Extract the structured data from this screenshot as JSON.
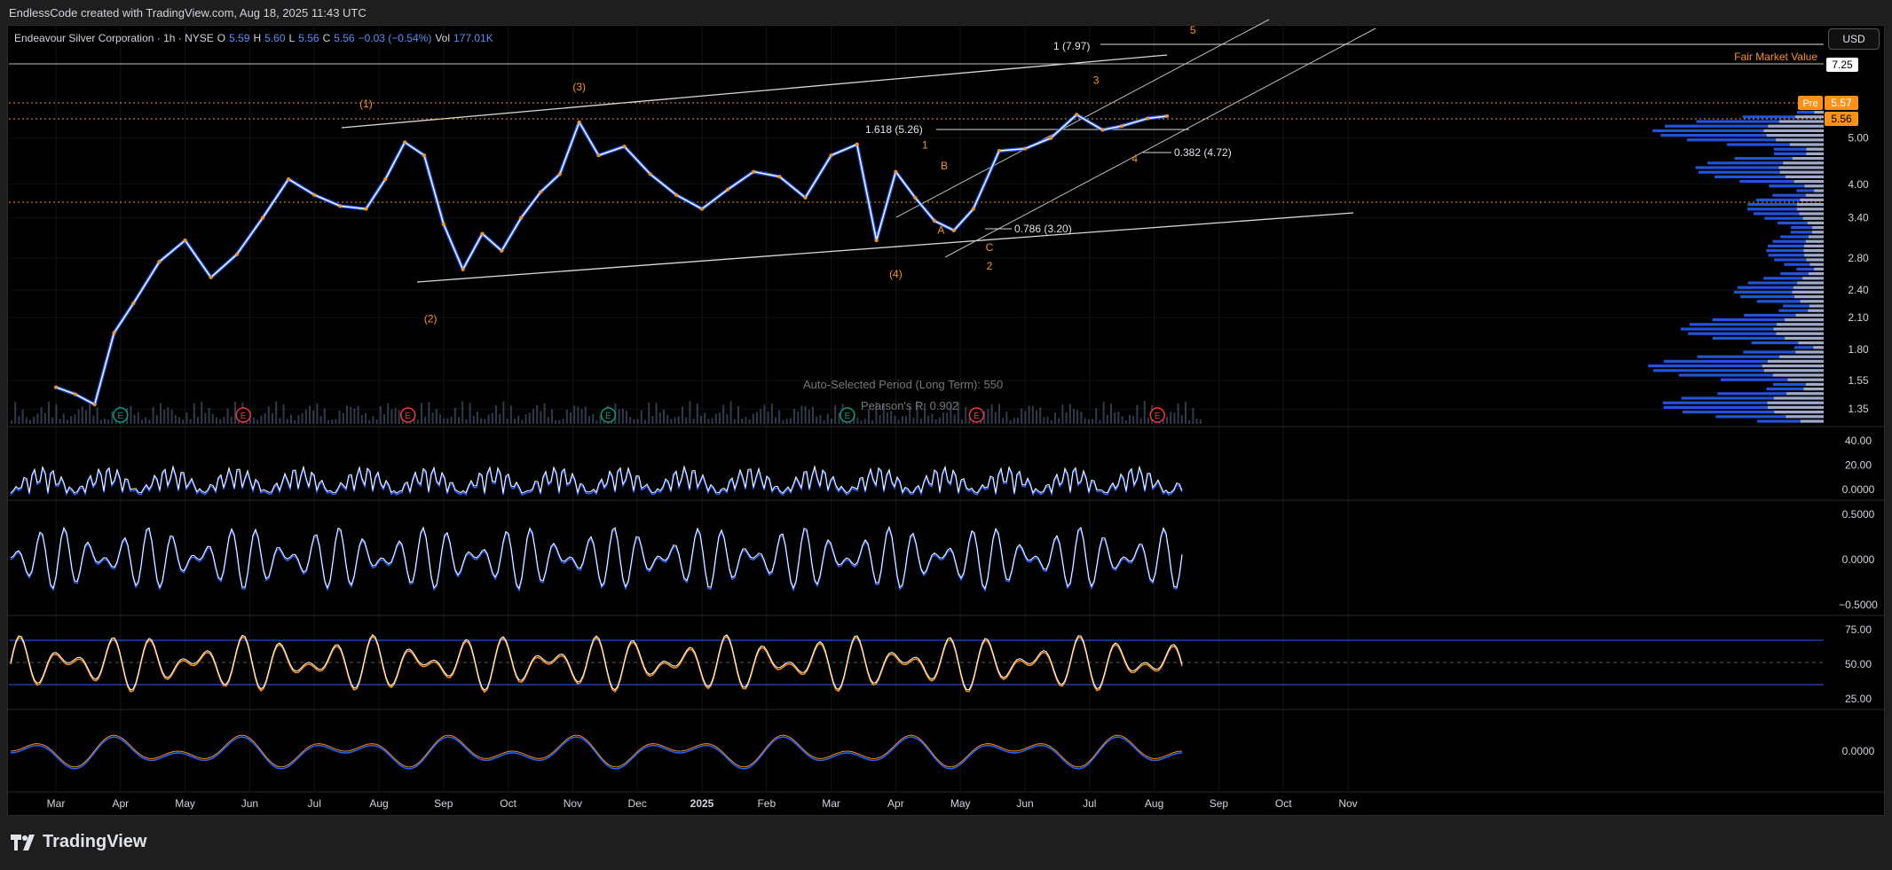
{
  "header": {
    "title": "EndlessCode created with TradingView.com, Aug 18, 2025 11:43 UTC"
  },
  "legend": {
    "symbol": "Endeavour Silver Corporation · 1h · NYSE",
    "o_label": "O",
    "o": "5.59",
    "h_label": "H",
    "h": "5.60",
    "l_label": "L",
    "l": "5.56",
    "c_label": "C",
    "c": "5.56",
    "change": "−0.03 (−0.54%)",
    "vol_label": "Vol",
    "vol": "177.01K"
  },
  "currency": "USD",
  "footer": {
    "brand": "TradingView"
  },
  "colors": {
    "accent": "#f7931a",
    "blue": "#2962ff",
    "white": "#ffffff",
    "bg": "#000000"
  },
  "chart_data": {
    "type": "line",
    "x_labels": [
      "Mar",
      "Apr",
      "May",
      "Jun",
      "Jul",
      "Aug",
      "Sep",
      "Oct",
      "Nov",
      "Dec",
      "2025",
      "Feb",
      "Mar",
      "Apr",
      "May",
      "Jun",
      "Jul",
      "Aug",
      "Sep",
      "Oct",
      "Nov"
    ],
    "price_ticks": [
      "5.00",
      "4.00",
      "3.40",
      "2.80",
      "2.40",
      "2.10",
      "1.80",
      "1.55",
      "1.35"
    ],
    "price_ylim": [
      1.3,
      7.6
    ],
    "price_series": {
      "x": [
        0,
        0.3,
        0.6,
        0.9,
        1.2,
        1.6,
        2.0,
        2.4,
        2.8,
        3.2,
        3.6,
        4.0,
        4.4,
        4.8,
        5.1,
        5.4,
        5.7,
        6.0,
        6.3,
        6.6,
        6.9,
        7.2,
        7.5,
        7.8,
        8.1,
        8.4,
        8.8,
        9.2,
        9.6,
        10.0,
        10.4,
        10.8,
        11.2,
        11.6,
        12.0,
        12.4,
        12.7,
        13.0,
        13.3,
        13.6,
        13.9,
        14.2,
        14.6,
        15.0,
        15.4,
        15.8,
        16.2,
        16.5,
        16.9,
        17.2
      ],
      "y": [
        1.5,
        1.45,
        1.38,
        1.95,
        2.25,
        2.75,
        3.05,
        2.55,
        2.85,
        3.4,
        4.1,
        3.8,
        3.6,
        3.55,
        4.1,
        4.9,
        4.6,
        3.3,
        2.65,
        3.15,
        2.9,
        3.4,
        3.85,
        4.2,
        5.4,
        4.6,
        4.8,
        4.2,
        3.8,
        3.55,
        3.9,
        4.25,
        4.15,
        3.75,
        4.6,
        4.85,
        3.05,
        4.25,
        3.75,
        3.35,
        3.2,
        3.55,
        4.7,
        4.75,
        5.0,
        5.6,
        5.2,
        5.3,
        5.5,
        5.56
      ]
    },
    "price_markers": {
      "fair_market_value": {
        "label": "Fair Market Value",
        "price": "7.25"
      },
      "pre_label": "Pre",
      "pre_price": "5.57",
      "last_price": "5.56"
    },
    "annotations": {
      "fib_1": "1 (7.97)",
      "fib_1618": "1.618 (5.26)",
      "fib_0382": "0.382 (4.72)",
      "fib_0786": "0.786 (3.20)",
      "auto_period": "Auto-Selected Period (Long Term): 550",
      "pearson": "Pearson's R: 0.902"
    },
    "elliott_labels": [
      {
        "text": "(1)",
        "x": 4.8,
        "y": 5.8
      },
      {
        "text": "(2)",
        "x": 5.8,
        "y": 2.05
      },
      {
        "text": "(3)",
        "x": 8.1,
        "y": 6.3
      },
      {
        "text": "(4)",
        "x": 13.0,
        "y": 2.55
      },
      {
        "text": "5",
        "x": 17.6,
        "y": 9.6
      },
      {
        "text": "1",
        "x": 13.45,
        "y": 4.75
      },
      {
        "text": "B",
        "x": 13.75,
        "y": 4.3
      },
      {
        "text": "A",
        "x": 13.7,
        "y": 3.15
      },
      {
        "text": "C",
        "x": 14.45,
        "y": 2.9
      },
      {
        "text": "2",
        "x": 14.45,
        "y": 2.65
      },
      {
        "text": "3",
        "x": 16.1,
        "y": 6.5
      },
      {
        "text": "4",
        "x": 16.7,
        "y": 4.45
      }
    ],
    "earnings_badges": [
      {
        "text": "E",
        "x": 1.0,
        "kind": "green"
      },
      {
        "text": "E",
        "x": 2.9,
        "kind": "red"
      },
      {
        "text": "E",
        "x": 5.45,
        "kind": "red"
      },
      {
        "text": "E",
        "x": 8.55,
        "kind": "green"
      },
      {
        "text": "E",
        "x": 12.25,
        "kind": "green"
      },
      {
        "text": "E",
        "x": 14.25,
        "kind": "red"
      },
      {
        "text": "E",
        "x": 17.05,
        "kind": "red"
      }
    ],
    "panels": [
      {
        "name": "volume-panel",
        "ticks": [
          "40.00",
          "20.00",
          "0.0000"
        ]
      },
      {
        "name": "momentum-panel",
        "ticks": [
          "0.5000",
          "0.0000",
          "−0.5000"
        ]
      },
      {
        "name": "rsi-panel",
        "ticks": [
          "75.00",
          "50.00",
          "25.00"
        ],
        "bands": [
          70,
          30
        ]
      },
      {
        "name": "oscillator-panel",
        "ticks": [
          "0.0000"
        ]
      }
    ]
  }
}
